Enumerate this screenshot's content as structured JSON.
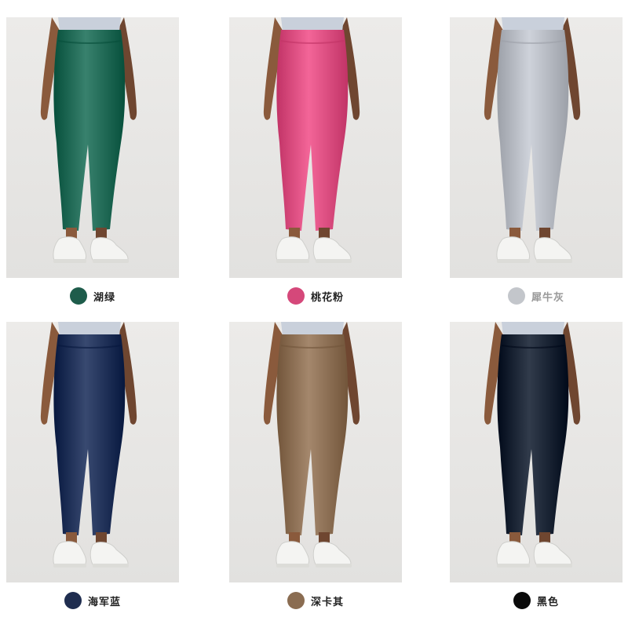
{
  "products": [
    {
      "name": "湖绿",
      "color": "#1e5c4b",
      "legging_shade": "#226b57",
      "label_style": "dark"
    },
    {
      "name": "桃花粉",
      "color": "#d5487a",
      "legging_shade": "#dd4f82",
      "label_style": "dark"
    },
    {
      "name": "犀牛灰",
      "color": "#c3c6cb",
      "legging_shade": "#b8bcc4",
      "label_style": "light"
    },
    {
      "name": "海军蓝",
      "color": "#1f2d4f",
      "legging_shade": "#22335a",
      "label_style": "dark"
    },
    {
      "name": "深卡其",
      "color": "#8a6c51",
      "legging_shade": "#8e7156",
      "label_style": "dark"
    },
    {
      "name": "黑色",
      "color": "#0a0a0a",
      "legging_shade": "#1b2535",
      "label_style": "dark"
    }
  ]
}
